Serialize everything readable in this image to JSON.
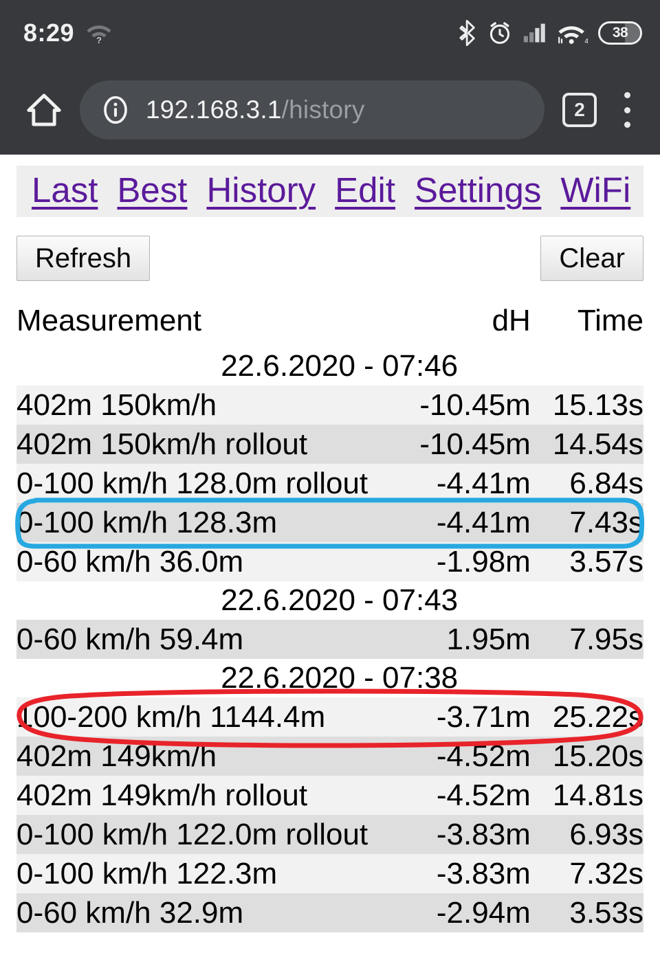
{
  "statusbar": {
    "time": "8:29",
    "battery_level": "38",
    "wifi_count": "4",
    "icons": [
      "wifi-no-internet-icon",
      "bluetooth-icon",
      "alarm-icon",
      "cell-signal-icon",
      "wifi-icon",
      "battery-icon"
    ]
  },
  "browser": {
    "url_host": "192.168.3.1",
    "url_path": "/history",
    "tab_count": "2",
    "icons": [
      "home-icon",
      "info-icon",
      "tab-count-icon",
      "more-options-icon"
    ]
  },
  "nav": {
    "items": [
      {
        "label": "Last"
      },
      {
        "label": "Best"
      },
      {
        "label": "History"
      },
      {
        "label": "Edit"
      },
      {
        "label": "Settings"
      },
      {
        "label": "WiFi"
      }
    ]
  },
  "toolbar": {
    "refresh_label": "Refresh",
    "clear_label": "Clear"
  },
  "table": {
    "headers": {
      "measurement": "Measurement",
      "dh": "dH",
      "time": "Time"
    },
    "rows": [
      {
        "type": "separator",
        "label": "22.6.2020 - 07:46"
      },
      {
        "type": "data",
        "measurement": "402m 150km/h",
        "dh": "-10.45m",
        "time": "15.13s"
      },
      {
        "type": "data",
        "measurement": "402m 150km/h rollout",
        "dh": "-10.45m",
        "time": "14.54s"
      },
      {
        "type": "data",
        "measurement": "0-100 km/h 128.0m rollout",
        "dh": "-4.41m",
        "time": "6.84s"
      },
      {
        "type": "data",
        "measurement": "0-100 km/h 128.3m",
        "dh": "-4.41m",
        "time": "7.43s"
      },
      {
        "type": "data",
        "measurement": "0-60 km/h 36.0m",
        "dh": "-1.98m",
        "time": "3.57s"
      },
      {
        "type": "separator",
        "label": "22.6.2020 - 07:43"
      },
      {
        "type": "data",
        "measurement": "0-60 km/h 59.4m",
        "dh": "1.95m",
        "time": "7.95s"
      },
      {
        "type": "separator",
        "label": "22.6.2020 - 07:38"
      },
      {
        "type": "data",
        "measurement": "100-200 km/h 1144.4m",
        "dh": "-3.71m",
        "time": "25.22s"
      },
      {
        "type": "data",
        "measurement": "402m 149km/h",
        "dh": "-4.52m",
        "time": "15.20s"
      },
      {
        "type": "data",
        "measurement": "402m 149km/h rollout",
        "dh": "-4.52m",
        "time": "14.81s"
      },
      {
        "type": "data",
        "measurement": "0-100 km/h 122.0m rollout",
        "dh": "-3.83m",
        "time": "6.93s"
      },
      {
        "type": "data",
        "measurement": "0-100 km/h 122.3m",
        "dh": "-3.83m",
        "time": "7.32s"
      },
      {
        "type": "data",
        "measurement": "0-60 km/h 32.9m",
        "dh": "-2.94m",
        "time": "3.53s"
      }
    ]
  },
  "annotations": [
    {
      "name": "blue-highlight-rect",
      "shape": "rounded-rect",
      "color": "#27a8e0",
      "target_row": "0-100 km/h 128.3m"
    },
    {
      "name": "red-highlight-ellipse",
      "shape": "ellipse",
      "color": "#e8232a",
      "target_row": "100-200 km/h 1144.4m"
    }
  ]
}
